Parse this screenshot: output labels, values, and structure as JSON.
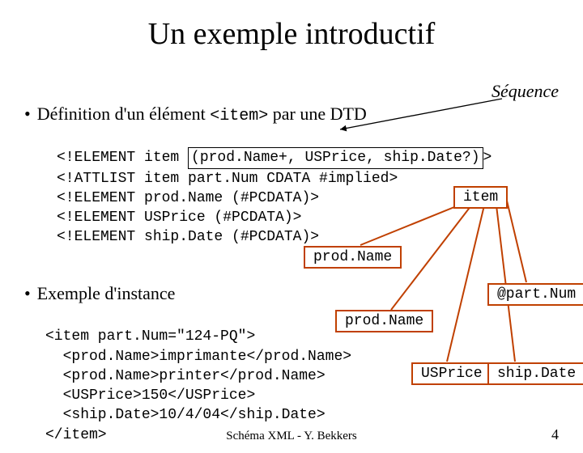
{
  "title": "Un exemple introductif",
  "sequence_label": "Séquence",
  "bullet1_prefix": "Définition d'un élément ",
  "bullet1_code": "<item>",
  "bullet1_suffix": " par une DTD",
  "dtd": {
    "l1a": "<!ELEMENT item ",
    "l1b": "(prod.Name+, USPrice, ship.Date?)",
    "l1c": ">",
    "l2": "<!ATTLIST item part.Num CDATA #implied>",
    "l3": "<!ELEMENT prod.Name (#PCDATA)>",
    "l4": "<!ELEMENT USPrice (#PCDATA)>",
    "l5": "<!ELEMENT ship.Date (#PCDATA)>"
  },
  "bullet2": "Exemple d'instance",
  "instance": {
    "l1": "<item part.Num=\"124-PQ\">",
    "l2": "  <prod.Name>imprimante</prod.Name>",
    "l3": "  <prod.Name>printer</prod.Name>",
    "l4": "  <USPrice>150</USPrice>",
    "l5": "  <ship.Date>10/4/04</ship.Date>",
    "l6": "</item>"
  },
  "tree": {
    "root": "item",
    "c1": "prod.Name",
    "c2": "prod.Name",
    "c3": "USPrice",
    "c4": "ship.Date",
    "attr": "@part.Num"
  },
  "footer": "Schéma XML - Y. Bekkers",
  "page": "4"
}
